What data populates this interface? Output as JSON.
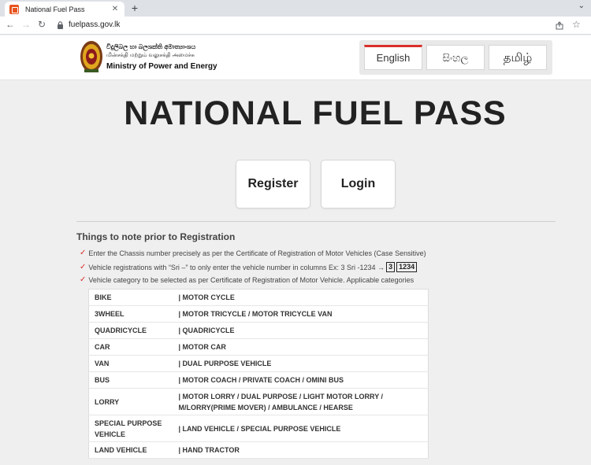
{
  "browser": {
    "tab_title": "National Fuel Pass",
    "tab_close": "✕",
    "new_tab": "+",
    "tab_menu": "⌄",
    "url": "fuelpass.gov.lk",
    "icons": [
      "back-icon",
      "forward-icon",
      "reload-icon",
      "lock-icon",
      "share-icon",
      "star-icon"
    ]
  },
  "header": {
    "ministry_sinhala": "විදුලිබල හා බලශක්ති අමාත්‍යාංශය",
    "ministry_tamil": "மின்சக்தி மற்றும் வலுசக்தி அமைச்சு",
    "ministry_english": "Ministry of Power and Energy",
    "languages": [
      {
        "label": "English",
        "active": true
      },
      {
        "label": "සිංහල",
        "active": false
      },
      {
        "label": "தமிழ்",
        "active": false
      }
    ],
    "accent_color": "#d9302b"
  },
  "main": {
    "title": "NATIONAL FUEL PASS",
    "register_label": "Register",
    "login_label": "Login",
    "notes_heading": "Things to note prior to Registration",
    "notes": [
      "Enter the Chassis number precisely as per the Certificate of Registration of Motor Vehicles (Case Sensitive)",
      "Vehicle registrations with “Sri –” to only enter the vehicle number in columns Ex: 3 Sri -1234 →",
      "Vehicle category to be selected as per Certificate of Registration of Motor Vehicle. Applicable categories"
    ],
    "plate_example": [
      "3",
      "1234"
    ],
    "categories": [
      {
        "name": "BIKE",
        "types": "| MOTOR CYCLE"
      },
      {
        "name": "3WHEEL",
        "types": "| MOTOR TRICYCLE / MOTOR TRICYCLE VAN"
      },
      {
        "name": "QUADRICYCLE",
        "types": "| QUADRICYCLE"
      },
      {
        "name": "CAR",
        "types": "| MOTOR CAR"
      },
      {
        "name": "VAN",
        "types": "| DUAL PURPOSE VEHICLE"
      },
      {
        "name": "BUS",
        "types": "| MOTOR COACH / PRIVATE COACH / OMINI BUS"
      },
      {
        "name": "LORRY",
        "types": "| MOTOR LORRY / DUAL PURPOSE / LIGHT MOTOR LORRY / M/LORRY(PRIME MOVER) / AMBULANCE / HEARSE"
      },
      {
        "name": "SPECIAL PURPOSE VEHICLE",
        "types": "| LAND VEHICLE / SPECIAL PURPOSE VEHICLE"
      },
      {
        "name": "LAND VEHICLE",
        "types": "| HAND TRACTOR"
      }
    ]
  }
}
